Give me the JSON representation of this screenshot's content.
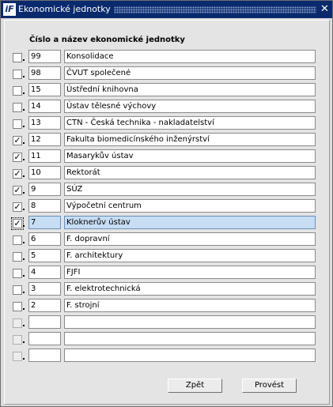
{
  "window": {
    "title": "Ekonomické jednotky",
    "close_icon": "close-icon",
    "app_icon": "oracle-forms-icon",
    "app_icon_text": "iF"
  },
  "header": "Číslo a název ekonomické jednotky",
  "rows": [
    {
      "checked": false,
      "code": "99",
      "name": "Konsolidace"
    },
    {
      "checked": false,
      "code": "98",
      "name": "ČVUT společené"
    },
    {
      "checked": false,
      "code": "15",
      "name": "Ústřední knihovna"
    },
    {
      "checked": false,
      "code": "14",
      "name": "Ústav tělesné výchovy"
    },
    {
      "checked": false,
      "code": "13",
      "name": "CTN - Česká technika - nakladatelství"
    },
    {
      "checked": true,
      "code": "12",
      "name": "Fakulta biomedicínského inženýrství"
    },
    {
      "checked": true,
      "code": "11",
      "name": "Masarykův ústav"
    },
    {
      "checked": true,
      "code": "10",
      "name": "Rektorát"
    },
    {
      "checked": true,
      "code": "9",
      "name": "SÚZ"
    },
    {
      "checked": true,
      "code": "8",
      "name": "Výpočetní centrum"
    },
    {
      "checked": true,
      "code": "7",
      "name": "Kloknerův ústav",
      "selected": true
    },
    {
      "checked": false,
      "code": "6",
      "name": "F. dopravní"
    },
    {
      "checked": false,
      "code": "5",
      "name": "F. architektury"
    },
    {
      "checked": false,
      "code": "4",
      "name": "FJFI"
    },
    {
      "checked": false,
      "code": "3",
      "name": "F. elektrotechnická"
    },
    {
      "checked": false,
      "code": "2",
      "name": "F. strojní"
    },
    {
      "checked": false,
      "code": "",
      "name": "",
      "empty": true
    },
    {
      "checked": false,
      "code": "",
      "name": "",
      "empty": true
    },
    {
      "checked": false,
      "code": "",
      "name": "",
      "empty": true
    }
  ],
  "buttons": {
    "back": "Zpět",
    "run": "Provést"
  },
  "colors": {
    "titlebar": "#0a2a6e",
    "selected_row": "#c6ddf4"
  }
}
